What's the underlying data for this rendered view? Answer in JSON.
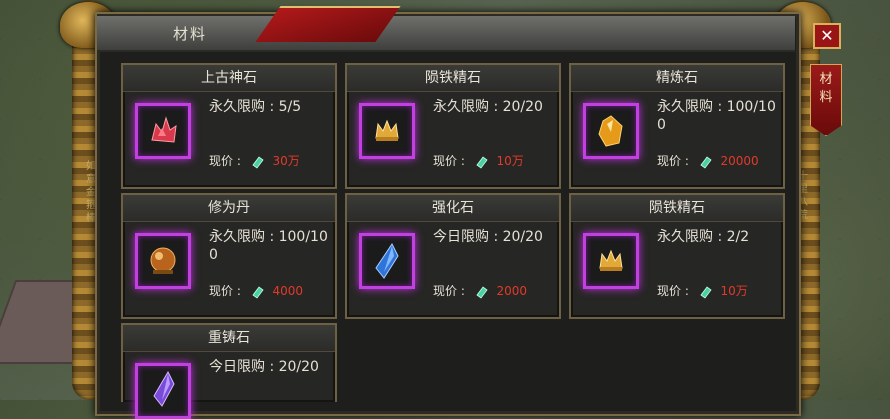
{
  "window": {
    "title": "材料",
    "close_label": "✕",
    "side_tab_label": "材料"
  },
  "decor": {
    "left_vertical_text": "如意金箍棒",
    "right_vertical_text": "十里八荒"
  },
  "price_label": "现价 :",
  "cards": [
    {
      "name": "上古神石",
      "limit": "永久限购 : 5/5",
      "price": "30万",
      "icon": "red-crystal-icon"
    },
    {
      "name": "陨铁精石",
      "limit": "永久限购 : 20/20",
      "price": "10万",
      "icon": "golden-crown-icon"
    },
    {
      "name": "精炼石",
      "limit": "永久限购 : 100/100",
      "price": "20000",
      "icon": "amber-stone-icon"
    },
    {
      "name": "修为丹",
      "limit": "永久限购 : 100/100",
      "price": "4000",
      "icon": "orange-pill-icon"
    },
    {
      "name": "强化石",
      "limit": "今日限购 : 20/20",
      "price": "2000",
      "icon": "blue-crystal-icon"
    },
    {
      "name": "陨铁精石",
      "limit": "永久限购 : 2/2",
      "price": "10万",
      "icon": "golden-crown-icon"
    },
    {
      "name": "重铸石",
      "limit": "今日限购 : 20/20",
      "price": "",
      "icon": "purple-crystal-icon"
    }
  ],
  "colors": {
    "price": "#e23a2a",
    "slot_glow": "#c040e0",
    "frame_gold": "#d7b25a"
  }
}
